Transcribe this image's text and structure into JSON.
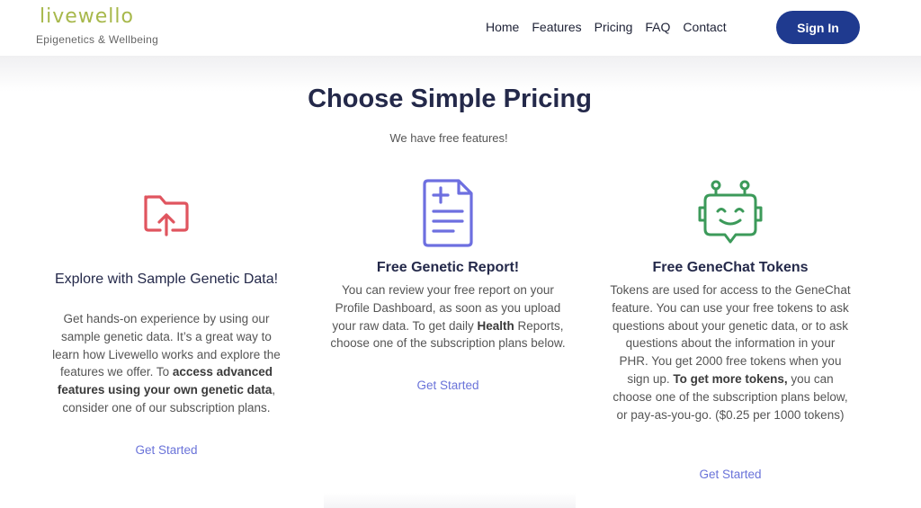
{
  "brand": {
    "name": "livewello",
    "tagline": "Epigenetics & Wellbeing",
    "accent": "#a7b84b"
  },
  "nav": {
    "items": [
      "Home",
      "Features",
      "Pricing",
      "FAQ",
      "Contact"
    ],
    "signin": "Sign In",
    "signin_color": "#1f3a8f"
  },
  "hero": {
    "title": "Choose Simple Pricing",
    "subtitle": "We have free features!"
  },
  "cards": [
    {
      "icon": "folder-upload-icon",
      "icon_color": "#e0555f",
      "title": "Explore with Sample Genetic Data!",
      "text_a": "Get hands-on experience by using our sample genetic data. It’s a great way to learn how Livewello works and explore the features we offer. To ",
      "text_bold": "access advanced features using your own genetic data",
      "text_b": ", consider one of our subscription plans.",
      "cta": "Get Started"
    },
    {
      "icon": "document-plus-icon",
      "icon_color": "#6d6fe0",
      "title": "Free Genetic Report!",
      "text_a": "You can review your free report on your Profile Dashboard, as soon as you upload your raw data. To get daily ",
      "text_bold": "Health",
      "text_b": " Reports, choose one of the subscription plans below.",
      "cta": "Get Started"
    },
    {
      "icon": "robot-chat-icon",
      "icon_color": "#3c9a5a",
      "title": "Free GeneChat Tokens",
      "text_a": "Tokens are used for access to the GeneChat feature. You can use your free tokens to ask questions about your genetic data, or to ask questions about the information in your PHR. You get 2000 free tokens when you sign up. ",
      "text_bold": "To get more tokens,",
      "text_b": " you can choose one of the subscription plans below, or pay-as-you-go. ($0.25 per 1000 tokens)",
      "cta": "Get Started"
    }
  ]
}
